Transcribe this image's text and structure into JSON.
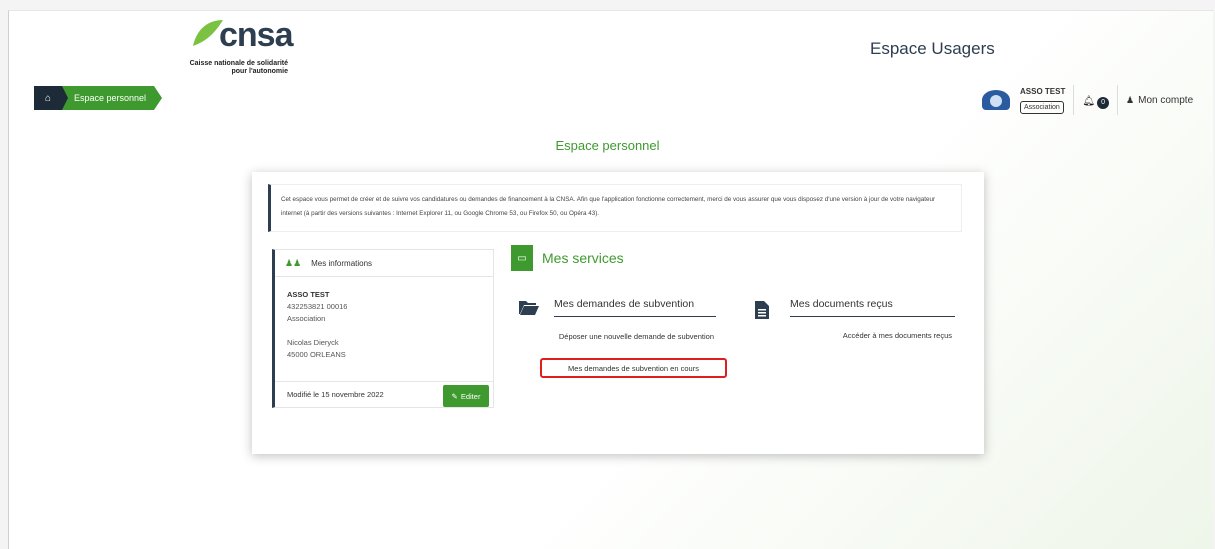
{
  "header": {
    "logo_text": "cnsa",
    "logo_sub": "Caisse nationale de solidarité pour l'autonomie",
    "app_title": "Espace Usagers"
  },
  "breadcrumb": {
    "current": "Espace personnel"
  },
  "user": {
    "name": "ASSO TEST",
    "badge": "Association",
    "notifications": "0",
    "account_label": "Mon compte"
  },
  "page": {
    "title": "Espace personnel"
  },
  "intro": {
    "text": "Cet espace vous permet de créer et de suivre vos candidatures ou demandes de financement à la CNSA. Afin que l'application fonctionne correctement, merci de vous assurer que vous disposez d'une version à jour de votre navigateur internet (à partir des versions suivantes : Internet Explorer 11, ou Google Chrome 53, ou Firefox 50, ou Opéra 43)."
  },
  "info": {
    "header": "Mes informations",
    "org_name": "ASSO TEST",
    "siret": "432253821 00016",
    "type": "Association",
    "contact": "Nicolas Dieryck",
    "city": "45000 ORLEANS",
    "modified": "Modifié le 15 novembre 2022",
    "edit_label": "Editer"
  },
  "services": {
    "title": "Mes services",
    "grants": {
      "title": "Mes demandes de subvention",
      "new_request": "Déposer une nouvelle demande de subvention",
      "in_progress": "Mes demandes de subvention en cours"
    },
    "documents": {
      "title": "Mes documents reçus",
      "link": "Accéder à mes documents reçus"
    }
  },
  "colors": {
    "green": "#3e9a2f",
    "navy": "#2d3e50",
    "highlight": "#e01e1e"
  }
}
